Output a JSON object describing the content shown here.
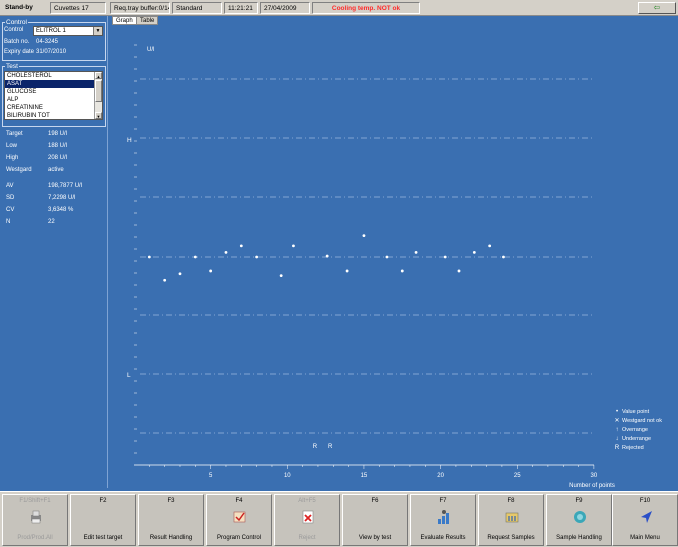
{
  "status": {
    "mode": "Stand-by",
    "cuvettes": "Cuvettes 17",
    "tray": "Req.tray buffer:0/14",
    "standard": "Standard",
    "time": "11:21:21",
    "date": "27/04/2009",
    "warning": "Cooling temp. NOT ok",
    "arrow_button": "⇦"
  },
  "control": {
    "legend": "Control",
    "control_label": "Control",
    "control_value": "ELITROL 1",
    "batch_label": "Batch no.",
    "batch_value": "04-3245",
    "expiry_label": "Expiry date",
    "expiry_value": "31/07/2010"
  },
  "test": {
    "legend": "Test",
    "items": [
      "CHOLESTEROL",
      "ASAT",
      "GLUCOSE",
      "ALP",
      "CREATININE",
      "BILIRUBIN TOT"
    ],
    "selected": "ASAT"
  },
  "limits": {
    "target_label": "Target",
    "target_value": "198 U/l",
    "low_label": "Low",
    "low_value": "188 U/l",
    "high_label": "High",
    "high_value": "208 U/l",
    "westgard_label": "Westgard",
    "westgard_value": "active"
  },
  "stats": {
    "av_label": "AV",
    "av_value": "198,7877 U/l",
    "sd_label": "SD",
    "sd_value": "7,2298 U/l",
    "cv_label": "CV",
    "cv_value": "3,6348 %",
    "n_label": "N",
    "n_value": "22"
  },
  "tabs": [
    "Graph",
    "Table"
  ],
  "chart_data": {
    "type": "scatter",
    "ylabel": "U/l",
    "xlabel": "Number of points",
    "xlim": [
      0,
      30
    ],
    "xticks": [
      "5",
      "10",
      "15",
      "20",
      "25",
      "30"
    ],
    "y_markers": [
      "H",
      "L"
    ],
    "rejected_labels": [
      "R",
      "R"
    ],
    "series": [
      {
        "x": [
          1,
          2,
          3,
          4,
          5,
          6,
          7,
          8,
          9.6,
          10.4,
          12.6,
          13.9,
          15,
          16.5,
          17.5,
          18.4,
          20.3,
          21.2,
          22.2,
          23.2,
          24.1
        ],
        "y": [
          0.0,
          -2.5,
          -1.8,
          0.0,
          -1.5,
          0.5,
          1.2,
          0.0,
          -2.0,
          1.2,
          0.1,
          -1.5,
          2.3,
          0.0,
          -1.5,
          0.5,
          0.0,
          -1.5,
          0.5,
          1.2,
          0.0
        ]
      }
    ],
    "legend": [
      "Value point",
      "Westgard not ok",
      "Overrange",
      "Underrange",
      "Rejected"
    ],
    "legend_glyphs": [
      "•",
      "✕",
      "↑",
      "↓",
      "R"
    ]
  },
  "fkeys": [
    {
      "key": "F1/Shift+F1",
      "label": "Prod/Prod.All",
      "icon": "printer-icon",
      "enabled": false
    },
    {
      "key": "F2",
      "label": "Edit test target",
      "icon": "",
      "enabled": true
    },
    {
      "key": "F3",
      "label": "Result Handling",
      "icon": "",
      "enabled": true
    },
    {
      "key": "F4",
      "label": "Program Control",
      "icon": "program-control-icon",
      "enabled": true
    },
    {
      "key": "Alt+F5",
      "label": "Reject",
      "icon": "reject-icon",
      "enabled": false
    },
    {
      "key": "F6",
      "label": "View by test",
      "icon": "",
      "enabled": true
    },
    {
      "key": "F7",
      "label": "Evaluate Results",
      "icon": "evaluate-icon",
      "enabled": true
    },
    {
      "key": "F8",
      "label": "Request Samples",
      "icon": "request-samples-icon",
      "enabled": true
    },
    {
      "key": "F9",
      "label": "Sample Handling",
      "icon": "sample-handling-icon",
      "enabled": true
    },
    {
      "key": "F10",
      "label": "Main Menu",
      "icon": "main-menu-icon",
      "enabled": true
    }
  ]
}
